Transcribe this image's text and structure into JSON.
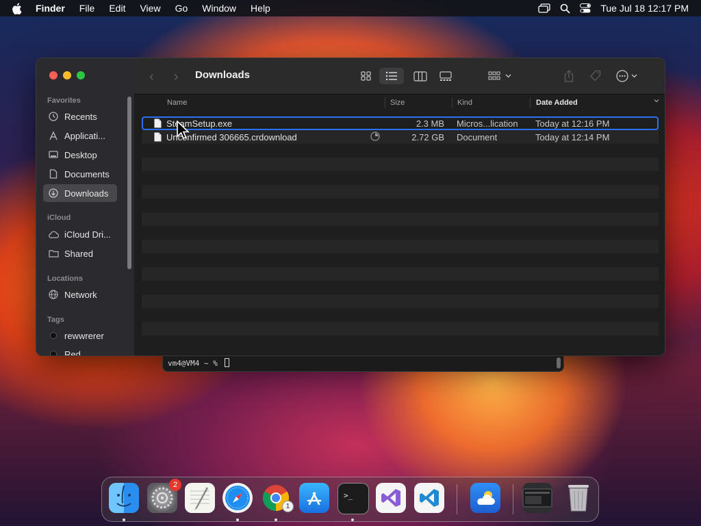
{
  "menubar": {
    "app_name": "Finder",
    "items": [
      "File",
      "Edit",
      "View",
      "Go",
      "Window",
      "Help"
    ],
    "clock": "Tue Jul 18  12:17 PM"
  },
  "finder": {
    "title": "Downloads",
    "sidebar": {
      "favorites_label": "Favorites",
      "favorites": [
        "Recents",
        "Applicati...",
        "Desktop",
        "Documents",
        "Downloads"
      ],
      "icloud_label": "iCloud",
      "icloud": [
        "iCloud Dri...",
        "Shared"
      ],
      "locations_label": "Locations",
      "locations": [
        "Network"
      ],
      "tags_label": "Tags",
      "tags": [
        "rewwrerer",
        "Red"
      ],
      "selected": "Downloads"
    },
    "columns": {
      "name": "Name",
      "size": "Size",
      "kind": "Kind",
      "date_added": "Date Added"
    },
    "files": [
      {
        "name": "SteamSetup.exe",
        "size": "2.3 MB",
        "kind": "Micros...lication",
        "date": "Today at 12:16 PM",
        "selected": true
      },
      {
        "name": "Unconfirmed 306665.crdownload",
        "size": "2.72 GB",
        "kind": "Document",
        "date": "Today at 12:14 PM",
        "selected": false
      }
    ]
  },
  "terminal": {
    "prompt": "vm4@VM4 ~ %"
  },
  "dock": {
    "apps": [
      "finder-icon",
      "system-settings-icon",
      "textedit-icon",
      "safari-icon",
      "chrome-icon",
      "app-store-icon",
      "terminal-icon",
      "visual-studio-icon",
      "vscode-icon",
      "weather-icon",
      "preview-window-icon",
      "trash-icon"
    ],
    "settings_badge": "2",
    "chrome_badge": "1"
  },
  "colors": {
    "selection_outline": "#2d6ff0",
    "close": "#ff5f57",
    "minimize": "#febc2e",
    "zoom": "#28c840"
  }
}
